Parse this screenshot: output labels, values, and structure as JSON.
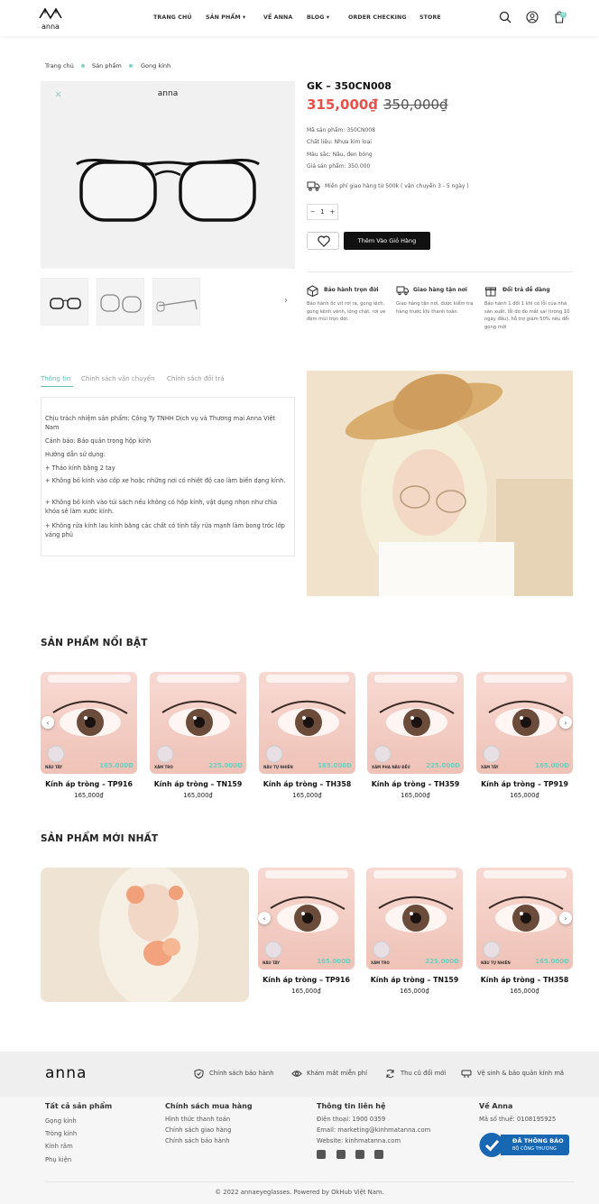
{
  "header": {
    "brand": "anna",
    "nav": [
      "TRANG CHỦ",
      "SẢN PHẨM",
      "VỀ ANNA",
      "BLOG",
      "ORDER CHECKING",
      "STORE"
    ],
    "cart_count": "0"
  },
  "breadcrumb": [
    "Trang chủ",
    "Sản phẩm",
    "Gọng kính"
  ],
  "product": {
    "title": "GK – 350CN008",
    "price": "315,000₫",
    "old_price": "350,000₫",
    "specs": [
      "Mã sản phẩm: 350CN008",
      "Chất liệu: Nhựa kim loại",
      "Màu sắc: Nâu, đen bóng",
      "Giá sản phẩm: 350.000"
    ],
    "shipping": "Miễn phí giao hàng từ 500k ( vận chuyển 3 - 5 ngày )",
    "quantity": "1",
    "add_to_cart": "Thêm Vào Giỏ Hàng"
  },
  "features": [
    {
      "title": "Bảo hành trọn đời",
      "desc": "Bảo hành ốc vít rơi ra, gọng lệch, gọng kênh vênh, lỏng chặt, rơi ve đệm mũi trọn đời."
    },
    {
      "title": "Giao hàng tận nơi",
      "desc": "Giao hàng tận nơi, được kiểm tra hàng trước khi thanh toán"
    },
    {
      "title": "Đổi trả dễ dàng",
      "desc": "Bảo hành 1 đổi 1 khi có lỗi của nhà sản xuất, lỗi do đo mắt sai (trong 10 ngày đầu), hỗ trợ giảm 50% nếu đổi gọng mới"
    }
  ],
  "tabs": [
    "Thông tin",
    "Chính sách vận chuyển",
    "Chính sách đổi trả"
  ],
  "info": [
    "Chịu trách nhiệm sản phẩm: Công Ty TNHH Dịch vụ và Thương mại Anna Việt Nam",
    "Cảnh báo: Bảo quản trong hộp kính",
    "Hướng dẫn sử dụng:",
    "+ Tháo kính bằng 2 tay",
    "+ Không bỏ kính vào cốp xe hoặc những nơi có nhiệt độ cao làm biến dạng kính.",
    "+ Không bỏ kính vào túi sách nếu không có hộp kính, vật dụng nhọn như chìa khóa sẽ làm xước kính.",
    "+ Không rửa kính lau kính bằng các chất có tính tẩy rửa mạnh làm bong tróc lớp váng phủ"
  ],
  "featured": {
    "title": "SẢN PHẨM NỔI BẬT",
    "items": [
      {
        "name": "Kính áp tròng – TP916",
        "price": "165,000₫",
        "tag": "NÂU TÂY",
        "img_price": "165.000Đ"
      },
      {
        "name": "Kính áp tròng – TN159",
        "price": "165,000₫",
        "tag": "XÁM TRO",
        "img_price": "225.000Đ"
      },
      {
        "name": "Kính áp tròng – TH358",
        "price": "165,000₫",
        "tag": "NÂU TỰ NHIÊN",
        "img_price": "165.000Đ"
      },
      {
        "name": "Kính áp tròng – TH359",
        "price": "165,000₫",
        "tag": "XÁM PHA NÂU ĐỀU",
        "img_price": "225.000Đ"
      },
      {
        "name": "Kính áp tròng – TP919",
        "price": "165,000₫",
        "tag": "XÁM TÂY",
        "img_price": "165.000Đ"
      }
    ]
  },
  "newest": {
    "title": "SẢN PHẨM MỚI NHẤT",
    "items": [
      {
        "name": "Kính áp tròng – TP916",
        "price": "165,000₫",
        "tag": "NÂU TÂY",
        "img_price": "165.000Đ"
      },
      {
        "name": "Kính áp tròng – TN159",
        "price": "165,000₫",
        "tag": "XÁM TRO",
        "img_price": "225.000Đ"
      },
      {
        "name": "Kính áp tròng – TH358",
        "price": "165,000₫",
        "tag": "NÂU TỰ NHIÊN",
        "img_price": "165.000Đ"
      }
    ]
  },
  "footer": {
    "brand": "anna",
    "policies": [
      "Chính sách bảo hành",
      "Khám mắt miễn phí",
      "Thu cũ đổi mới",
      "Vệ sinh & bảo quản kính mắ"
    ],
    "col1": {
      "title": "Tất cả sản phẩm",
      "links": [
        "Gọng kính",
        "Tròng kính",
        "Kính râm",
        "Phụ kiện"
      ]
    },
    "col2": {
      "title": "Chính sách mua hàng",
      "links": [
        "Hình thức thanh toán",
        "Chính sách giao hàng",
        "Chính sách bảo hành"
      ]
    },
    "col3": {
      "title": "Thông tin liên hệ",
      "links": [
        "Điện thoại: 1900 0359",
        "Email: marketing@kinhmatanna.com",
        "Website: kinhmatanna.com"
      ]
    },
    "col4": {
      "title": "Về Anna",
      "tax": "Mã số thuế: 0108195925",
      "badge_main": "ĐÃ THÔNG BÁO",
      "badge_sub": "BỘ CÔNG THƯƠNG"
    },
    "copyright": "© 2022 annaeyeglasses. Powered by OkHub Việt Nam."
  }
}
